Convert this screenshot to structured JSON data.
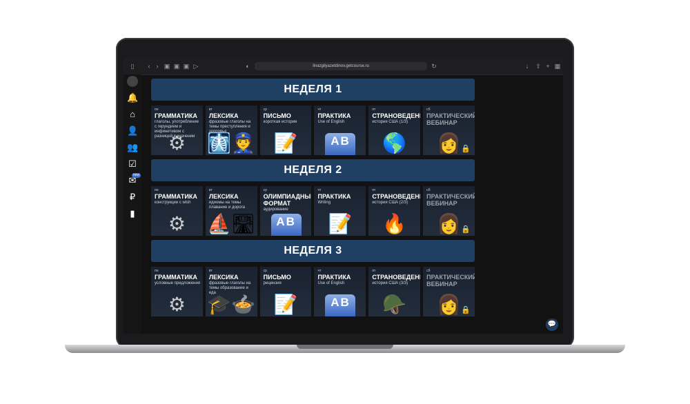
{
  "browser": {
    "url": "ilnazgilyazetdinov.getcourse.ru"
  },
  "sidebar": {
    "badge": "new"
  },
  "weeks": [
    {
      "title": "НЕДЕЛЯ 1",
      "cards": [
        {
          "day": "пн",
          "title": "ГРАММАТИКА",
          "sub": "глаголы, употребление с герундием и инфинитивом с разницей в значении",
          "icon": "⚙"
        },
        {
          "day": "вт",
          "title": "ЛЕКСИКА",
          "sub": "фразовые глаголы на темы преступления и здоровье",
          "icon": "🩻👮"
        },
        {
          "day": "ср",
          "title": "ПИСЬМО",
          "sub": "короткая история",
          "icon": "📝"
        },
        {
          "day": "чт",
          "title": "ПРАКТИКА",
          "sub": "Use of English",
          "icon": "AB"
        },
        {
          "day": "пт",
          "title": "СТРАНОВЕДЕНИЕ",
          "sub": "история США (1/3)",
          "icon": "🌎"
        },
        {
          "day": "сб",
          "title": "ПРАКТИЧЕСКИЙ ВЕБИНАР",
          "sub": "",
          "icon": "👩"
        }
      ]
    },
    {
      "title": "НЕДЕЛЯ 2",
      "cards": [
        {
          "day": "пн",
          "title": "ГРАММАТИКА",
          "sub": "конструкции с wish",
          "icon": "⚙"
        },
        {
          "day": "вт",
          "title": "ЛЕКСИКА",
          "sub": "идиомы на темы плавание и дорога",
          "icon": "⛵🛣"
        },
        {
          "day": "ср",
          "title": "ОЛИМПИАДНЫЙ ФОРМАТ",
          "sub": "аудирование",
          "icon": "AB"
        },
        {
          "day": "чт",
          "title": "ПРАКТИКА",
          "sub": "Writing",
          "icon": "📝"
        },
        {
          "day": "пт",
          "title": "СТРАНОВЕДЕНИЕ",
          "sub": "история США (2/3)",
          "icon": "🔥"
        },
        {
          "day": "сб",
          "title": "ПРАКТИЧЕСКИЙ ВЕБИНАР",
          "sub": "",
          "icon": "👩"
        }
      ]
    },
    {
      "title": "НЕДЕЛЯ 3",
      "cards": [
        {
          "day": "пн",
          "title": "ГРАММАТИКА",
          "sub": "условные предложения",
          "icon": "⚙"
        },
        {
          "day": "вт",
          "title": "ЛЕКСИКА",
          "sub": "фразовые глаголы на темы образование и еда",
          "icon": "🎓🍲"
        },
        {
          "day": "ср",
          "title": "ПИСЬМО",
          "sub": "рецензия",
          "icon": "📝"
        },
        {
          "day": "чт",
          "title": "ПРАКТИКА",
          "sub": "Use of English",
          "icon": "AB"
        },
        {
          "day": "пт",
          "title": "СТРАНОВЕДЕНИЕ",
          "sub": "история США (3/3)",
          "icon": "🪖"
        },
        {
          "day": "сб",
          "title": "ПРАКТИЧЕСКИЙ ВЕБИНАР",
          "sub": "",
          "icon": "👩"
        }
      ]
    }
  ]
}
